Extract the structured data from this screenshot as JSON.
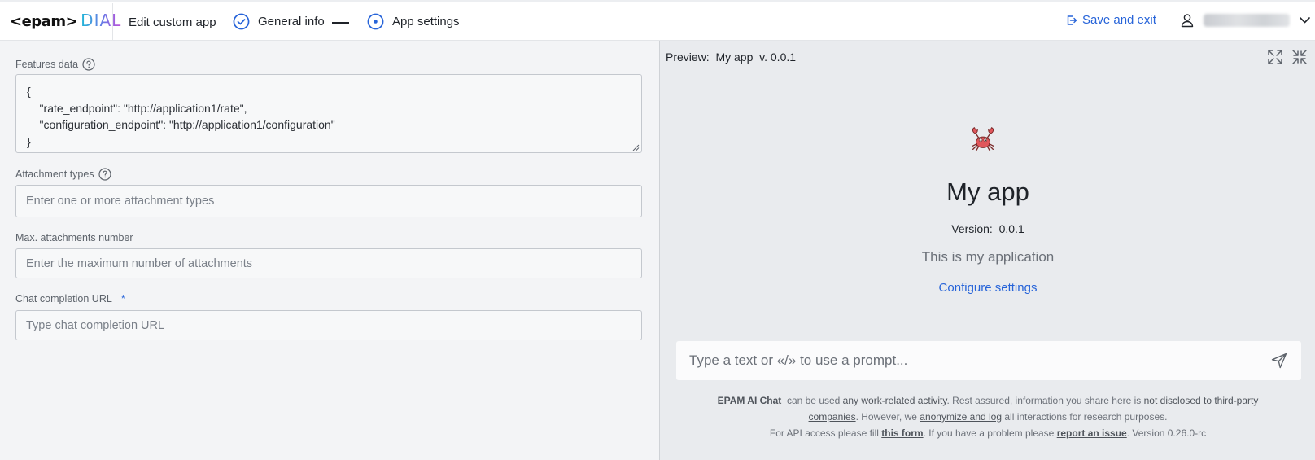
{
  "header": {
    "logo_text": "<epam>",
    "logo_product": "DIAL",
    "title": "Edit custom app",
    "steps": [
      {
        "label": "General info",
        "state": "done"
      },
      {
        "label": "App settings",
        "state": "current"
      }
    ],
    "save_exit_label": "Save and exit",
    "user_icon": "user-icon",
    "user_name": "",
    "accent_color": "#2764d9"
  },
  "form": {
    "features": {
      "label": "Features data",
      "value": "{\n    \"rate_endpoint\": \"http://application1/rate\",\n    \"configuration_endpoint\": \"http://application1/configuration\"\n}"
    },
    "attachment_types": {
      "label": "Attachment types",
      "placeholder": "Enter one or more attachment types"
    },
    "max_attachments": {
      "label": "Max. attachments number",
      "placeholder": "Enter the maximum number of attachments"
    },
    "completion_url": {
      "label": "Chat completion URL",
      "required_mark": "*",
      "placeholder": "Type chat completion URL"
    }
  },
  "preview": {
    "label": "Preview:  My app  v. 0.0.1",
    "app_name": "My app",
    "version_line": "Version:  0.0.1",
    "description": "This is my application",
    "configure_label": "Configure settings",
    "prompt_placeholder": "Type a text or «/» to use a prompt...",
    "footer": {
      "brand_link": "EPAM AI Chat",
      "t1": "  can be used ",
      "link_work": "any work-related activity",
      "t2": ". Rest assured, information you share here is ",
      "link_disclosed": "not disclosed to third-party companies",
      "t3": ". However, we ",
      "link_anon": "anonymize and log",
      "t4": " all interactions for research purposes.",
      "t5": "For API access please fill ",
      "link_form": "this form",
      "t6": ". If you have a problem please ",
      "link_issue": "report an issue",
      "t7": ". Version 0.26.0-rc"
    }
  }
}
